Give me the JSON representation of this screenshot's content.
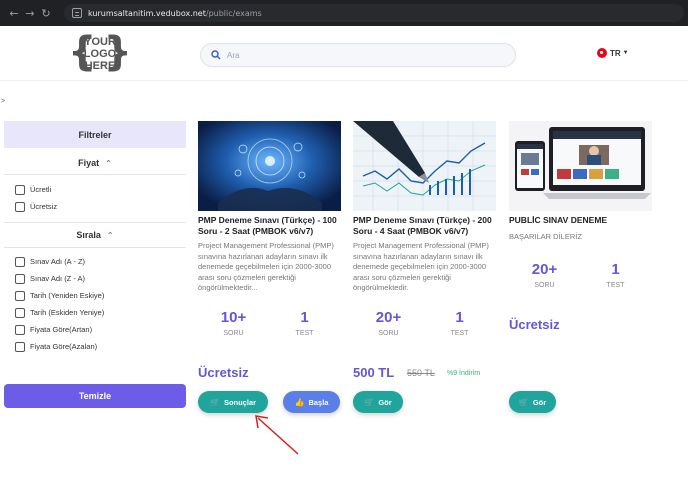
{
  "browser": {
    "back": "←",
    "forward": "→",
    "reload": "↻",
    "url_host": "kurumsaltanitim.vedubox.net",
    "url_path": "/public/exams"
  },
  "header": {
    "logo": [
      "YOUR",
      "LOGO",
      "HERE"
    ],
    "search_placeholder": "Ara",
    "language": "TR"
  },
  "breadcrumb": ">",
  "sidebar": {
    "title": "Filtreler",
    "price_title": "Fiyat",
    "price_options": [
      "Ücretli",
      "Ücretsiz"
    ],
    "sort_title": "Sırala",
    "sort_options": [
      "Sınav Adı (A - Z)",
      "Sınav Adı (Z - A)",
      "Tarih (Yeniden Eskiye)",
      "Tarih (Eskiden Yeniye)",
      "Fiyata Göre(Artan)",
      "Fiyata Göre(Azalan)"
    ],
    "clear_label": "Temizle"
  },
  "cards": [
    {
      "title": "PMP Deneme Sınavı (Türkçe) - 100 Soru - 2 Saat (PMBOK v6/v7)",
      "description": "Project Management Professional (PMP) sınavına hazırlanan adayların sınavı ilk denemede geçebilmeleri için 2000-3000 arası soru çözmeleri gerektiği öngörülmektedir...",
      "questions": "10+",
      "questions_label": "SORU",
      "tests": "1",
      "tests_label": "TEST",
      "price": "Ücretsiz",
      "button1": "Sonuçlar",
      "button2": "Başla"
    },
    {
      "title": "PMP Deneme Sınavı (Türkçe) - 200 Soru - 4 Saat (PMBOK v6/v7)",
      "description": "Project Management Professional (PMP) sınavına hazırlanan adayların sınavı ilk denemede geçebilmeleri için 2000-3000 arası soru çözmeleri gerektiği öngörülmektedir.",
      "questions": "20+",
      "questions_label": "SORU",
      "tests": "1",
      "tests_label": "TEST",
      "price": "500 TL",
      "old_price": "550 TL",
      "discount": "%9 İndirim",
      "button1": "Gör"
    },
    {
      "title": "PUBLİC SINAV DENEME",
      "subtitle": "BAŞARILAR DİLERİZ",
      "questions": "20+",
      "questions_label": "SORU",
      "tests": "1",
      "tests_label": "TEST",
      "price": "Ücretsiz",
      "button1": "Gör"
    }
  ],
  "colors": {
    "accent": "#6257d8",
    "button_primary": "#6c5ce7",
    "button_teal": "#1fa59b",
    "button_blue": "#5b7fe8",
    "annotation_arrow": "#d62020"
  }
}
